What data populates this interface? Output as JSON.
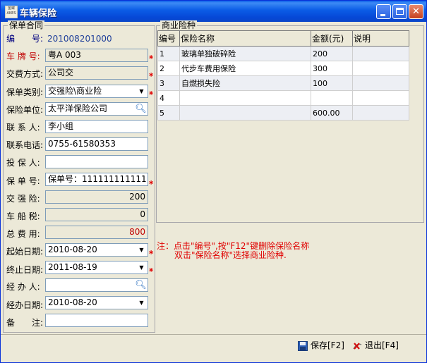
{
  "window": {
    "title": "车辆保险",
    "app_icon_text": "金蝶 AKES"
  },
  "left_group": {
    "legend": "保单合同"
  },
  "right_group": {
    "legend": "商业险种"
  },
  "form": {
    "number_label": "编　　号:",
    "number_value": "201008201000",
    "plate_label": "车 牌 号:",
    "plate_value": "粤A 003",
    "pay_method_label": "交费方式:",
    "pay_method_value": "公司交",
    "policy_type_label": "保单类别:",
    "policy_type_value": "交强险\\商业险",
    "insurer_label": "保险单位:",
    "insurer_value": "太平洋保险公司",
    "contact_label": "联 系 人:",
    "contact_value": "李小组",
    "phone_label": "联系电话:",
    "phone_value": "0755-61580353",
    "insured_label": "投 保 人:",
    "insured_value": "",
    "policy_no_label": "保 单 号:",
    "policy_no_value": "保单号：111111111111",
    "compulsory_label": "交 强 险:",
    "compulsory_value": "200",
    "vessel_tax_label": "车 船 税:",
    "vessel_tax_value": "0",
    "total_label": "总 费 用:",
    "total_value": "800",
    "start_date_label": "起始日期:",
    "start_date_value": "2010-08-20",
    "end_date_label": "终止日期:",
    "end_date_value": "2011-08-19",
    "handler_label": "经 办 人:",
    "handler_value": "",
    "handle_date_label": "经办日期:",
    "handle_date_value": "2010-08-20",
    "remark_label": "备　　注:",
    "remark_value": ""
  },
  "grid": {
    "columns": [
      "编号",
      "保险名称",
      "金额(元)",
      "说明"
    ],
    "rows": [
      [
        "1",
        "玻璃单独破碎险",
        "200",
        ""
      ],
      [
        "2",
        "代步车费用保险",
        "300",
        ""
      ],
      [
        "3",
        "自燃损失险",
        "100",
        ""
      ],
      [
        "4",
        "",
        "",
        ""
      ],
      [
        "5",
        "",
        "600.00",
        ""
      ]
    ]
  },
  "note": {
    "line1": "注：点击\"编号\",按\"F12\"键删除保险名称",
    "line2": "双击\"保险名称\"选择商业险种."
  },
  "buttons": {
    "save": "保存[F2]",
    "exit": "退出[F4]"
  },
  "icons": {
    "dropdown": "chevron-down-icon",
    "lookup": "magnifier-icon",
    "save": "floppy-disk-icon",
    "exit": "exit-icon"
  },
  "colors": {
    "title_bar": "#0a5ee8",
    "required_mark": "#e00000",
    "note_text": "#e00000",
    "window_bg": "#ece9d8"
  },
  "required_mark": "*"
}
